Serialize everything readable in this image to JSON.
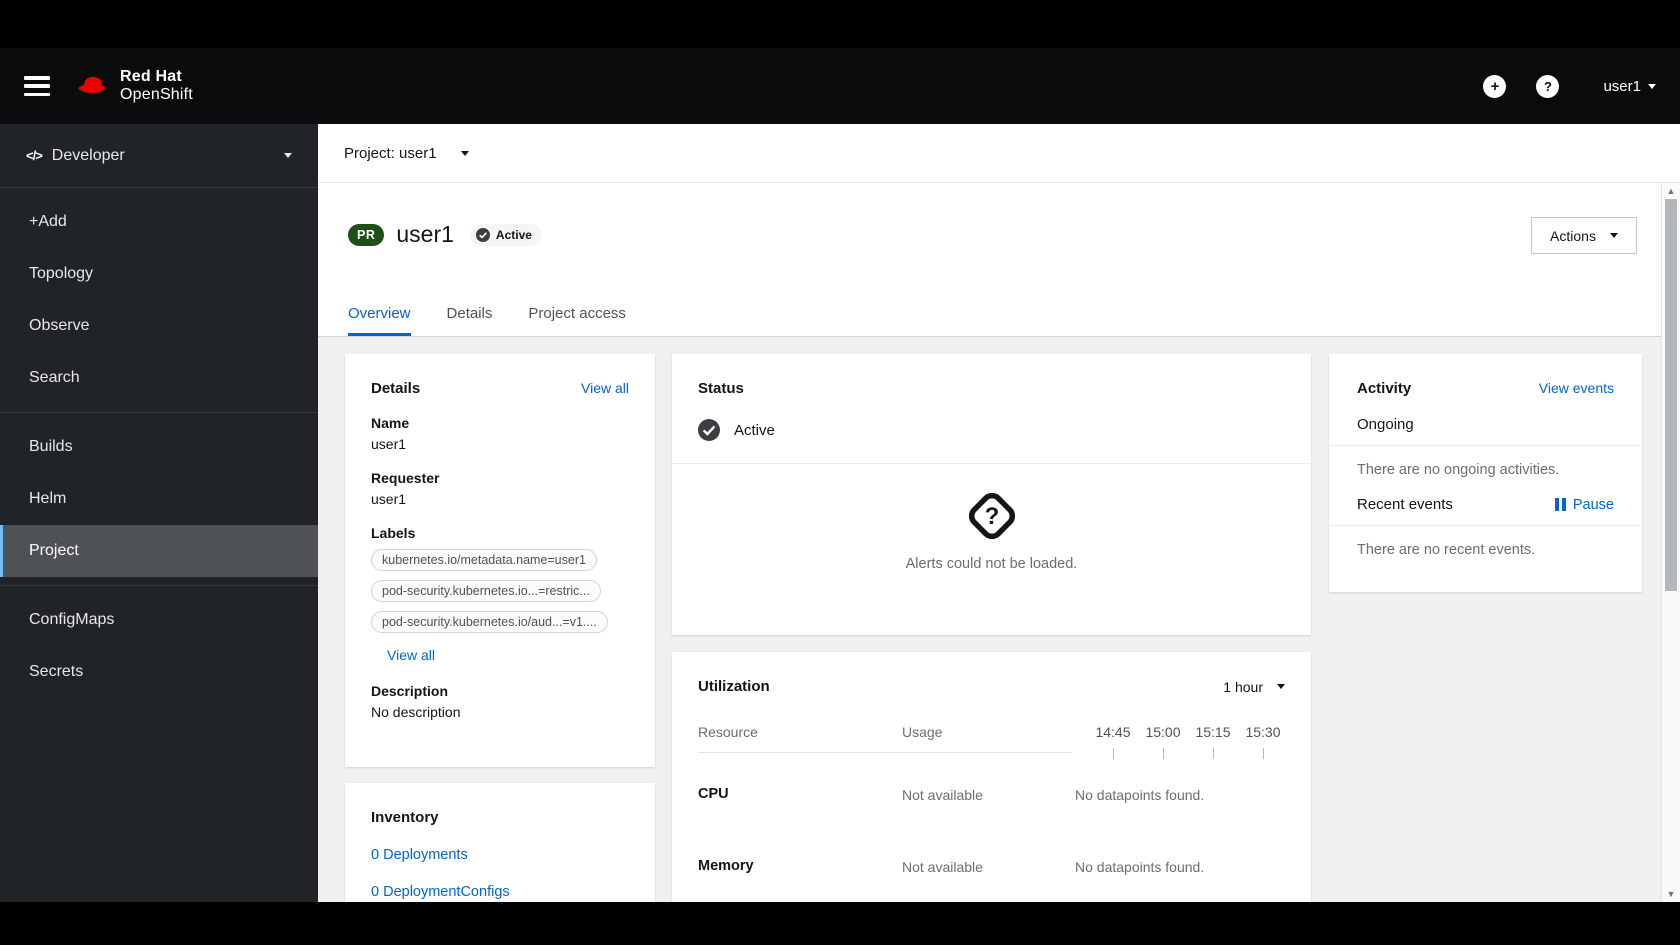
{
  "masthead": {
    "brand_line1": "Red Hat",
    "brand_line2": "OpenShift",
    "plus_glyph": "+",
    "help_glyph": "?",
    "user_menu": "user1"
  },
  "sidebar": {
    "perspective": "Developer",
    "perspective_icon": "</>",
    "groups": [
      {
        "items": [
          "+Add",
          "Topology",
          "Observe",
          "Search"
        ]
      },
      {
        "items": [
          "Builds",
          "Helm",
          "Project"
        ]
      },
      {
        "items": [
          "ConfigMaps",
          "Secrets"
        ]
      }
    ],
    "selected_item": "Project"
  },
  "toolbar": {
    "project_selector": "Project: user1"
  },
  "page_header": {
    "badge": "PR",
    "title": "user1",
    "status_badge": "Active",
    "actions_label": "Actions"
  },
  "tabs": {
    "items": [
      "Overview",
      "Details",
      "Project access"
    ],
    "active": "Overview"
  },
  "details_card": {
    "title": "Details",
    "view_all": "View all",
    "name_label": "Name",
    "name_value": "user1",
    "requester_label": "Requester",
    "requester_value": "user1",
    "labels_label": "Labels",
    "labels": [
      "kubernetes.io/metadata.name=user1",
      "pod-security.kubernetes.io...=restric...",
      "pod-security.kubernetes.io/aud...=v1...."
    ],
    "labels_view_all": "View all",
    "description_label": "Description",
    "description_value": "No description"
  },
  "inventory_card": {
    "title": "Inventory",
    "links": [
      "0 Deployments",
      "0 DeploymentConfigs"
    ]
  },
  "status_card": {
    "title": "Status",
    "status": "Active",
    "alerts_message": "Alerts could not be loaded."
  },
  "utilization_card": {
    "title": "Utilization",
    "duration": "1 hour",
    "resource_col": "Resource",
    "usage_col": "Usage",
    "times": [
      "14:45",
      "15:00",
      "15:15",
      "15:30"
    ],
    "rows": [
      {
        "name": "CPU",
        "usage": "Not available",
        "message": "No datapoints found."
      },
      {
        "name": "Memory",
        "usage": "Not available",
        "message": "No datapoints found."
      }
    ]
  },
  "activity_card": {
    "title": "Activity",
    "view_events": "View events",
    "ongoing_label": "Ongoing",
    "ongoing_empty": "There are no ongoing activities.",
    "recent_label": "Recent events",
    "pause_label": "Pause",
    "recent_empty": "There are no recent events."
  },
  "colors": {
    "accent_blue": "#0066cc",
    "brand_red": "#ee0000",
    "project_badge_green": "#1e4f18",
    "sidebar_bg": "#212427",
    "sidebar_selected": "#4f5255",
    "sidebar_accent": "#73bcf7",
    "page_bg": "#f0f0f2",
    "muted_text": "#6a6e73"
  }
}
